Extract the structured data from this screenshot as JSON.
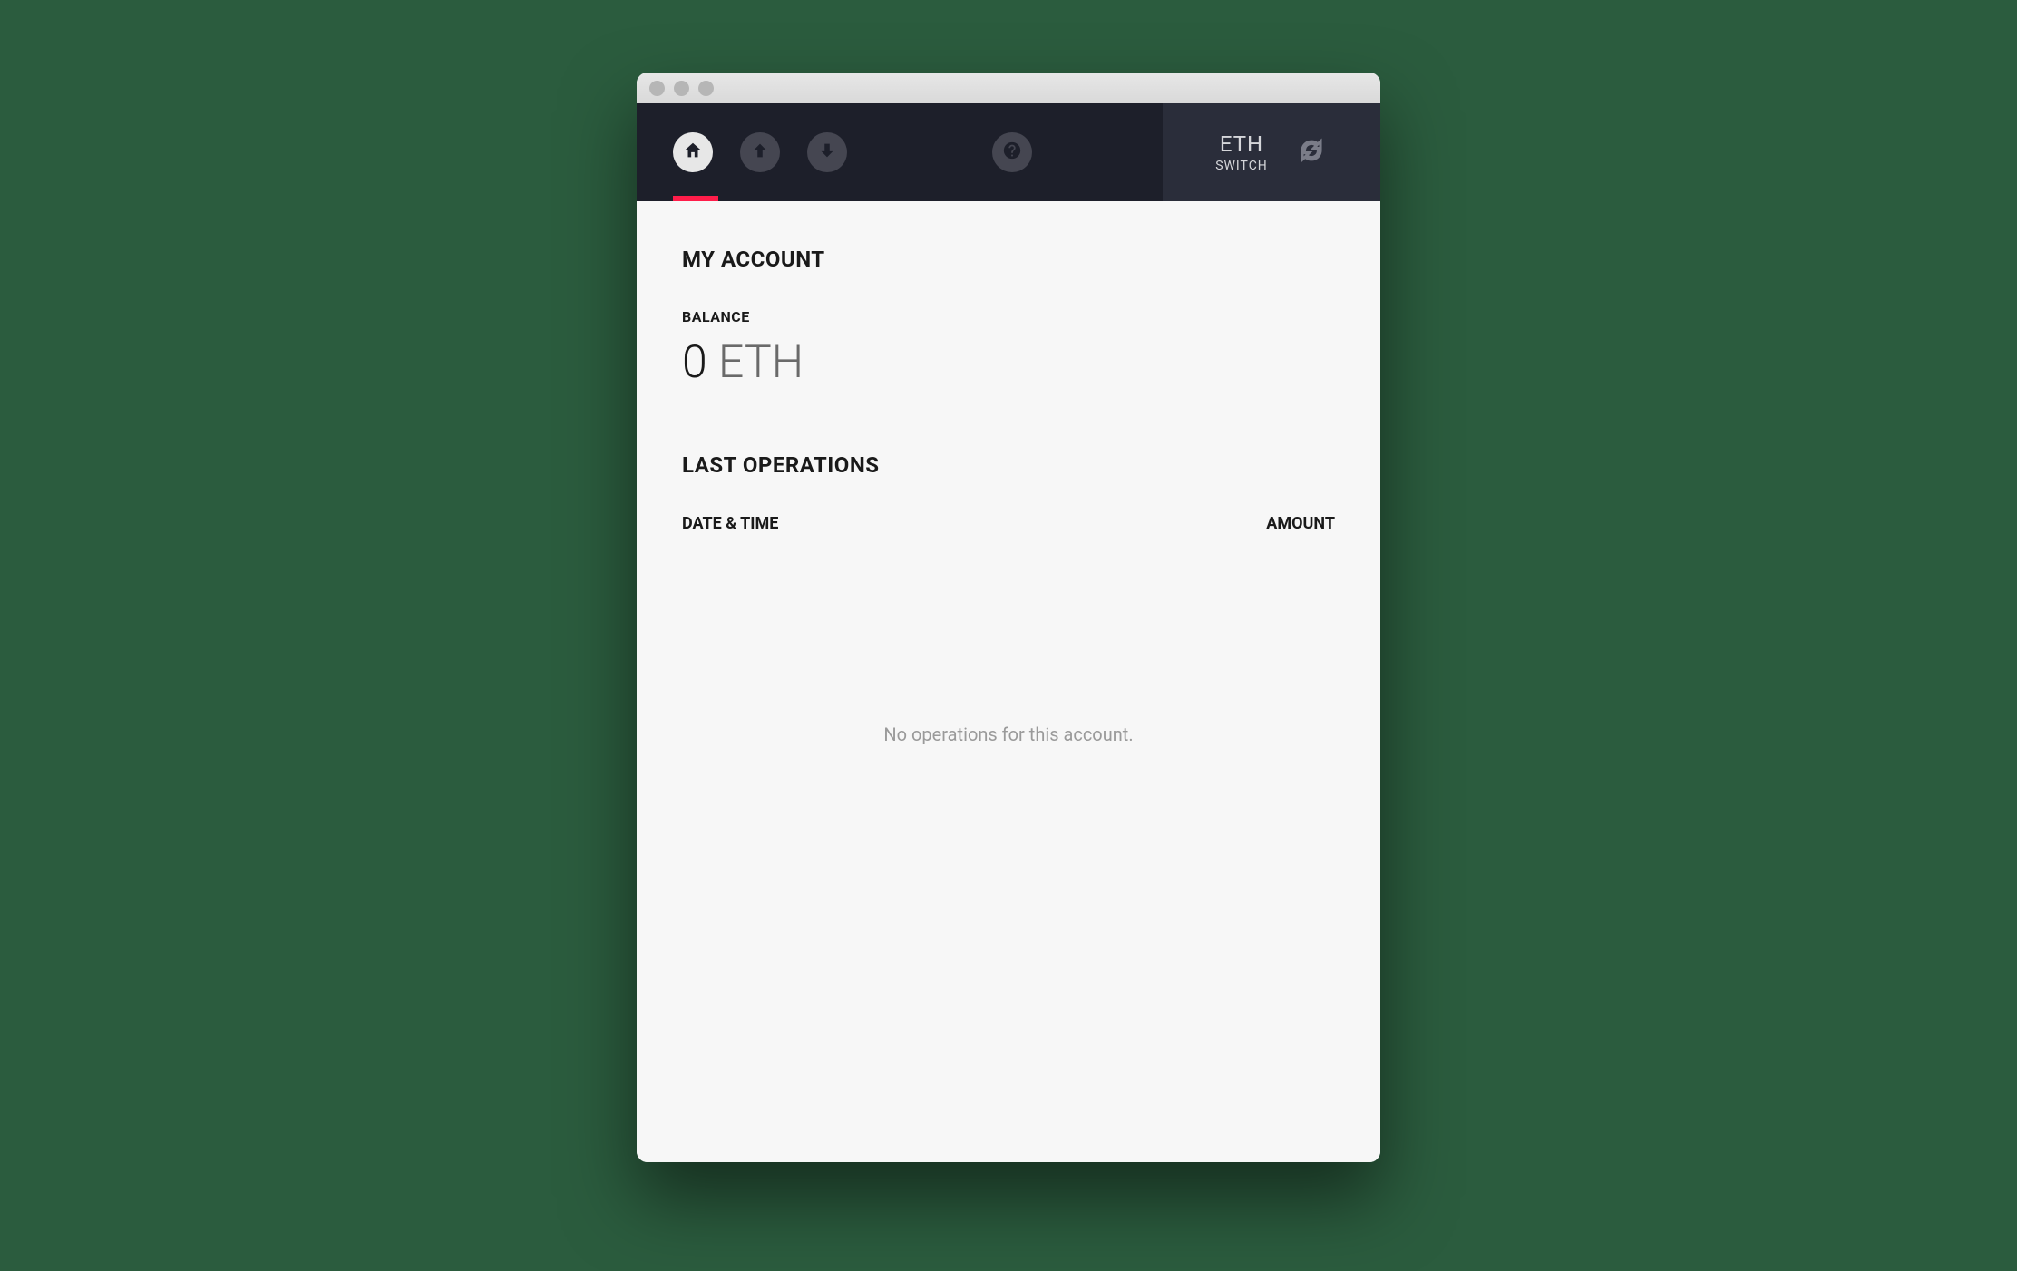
{
  "nav": {
    "currency": "ETH",
    "switch_label": "SWITCH"
  },
  "account": {
    "title": "MY ACCOUNT",
    "balance_label": "BALANCE",
    "balance_amount": "0",
    "balance_unit": "ETH"
  },
  "operations": {
    "title": "LAST OPERATIONS",
    "col_date": "DATE & TIME",
    "col_amount": "AMOUNT",
    "empty": "No operations for this account."
  }
}
